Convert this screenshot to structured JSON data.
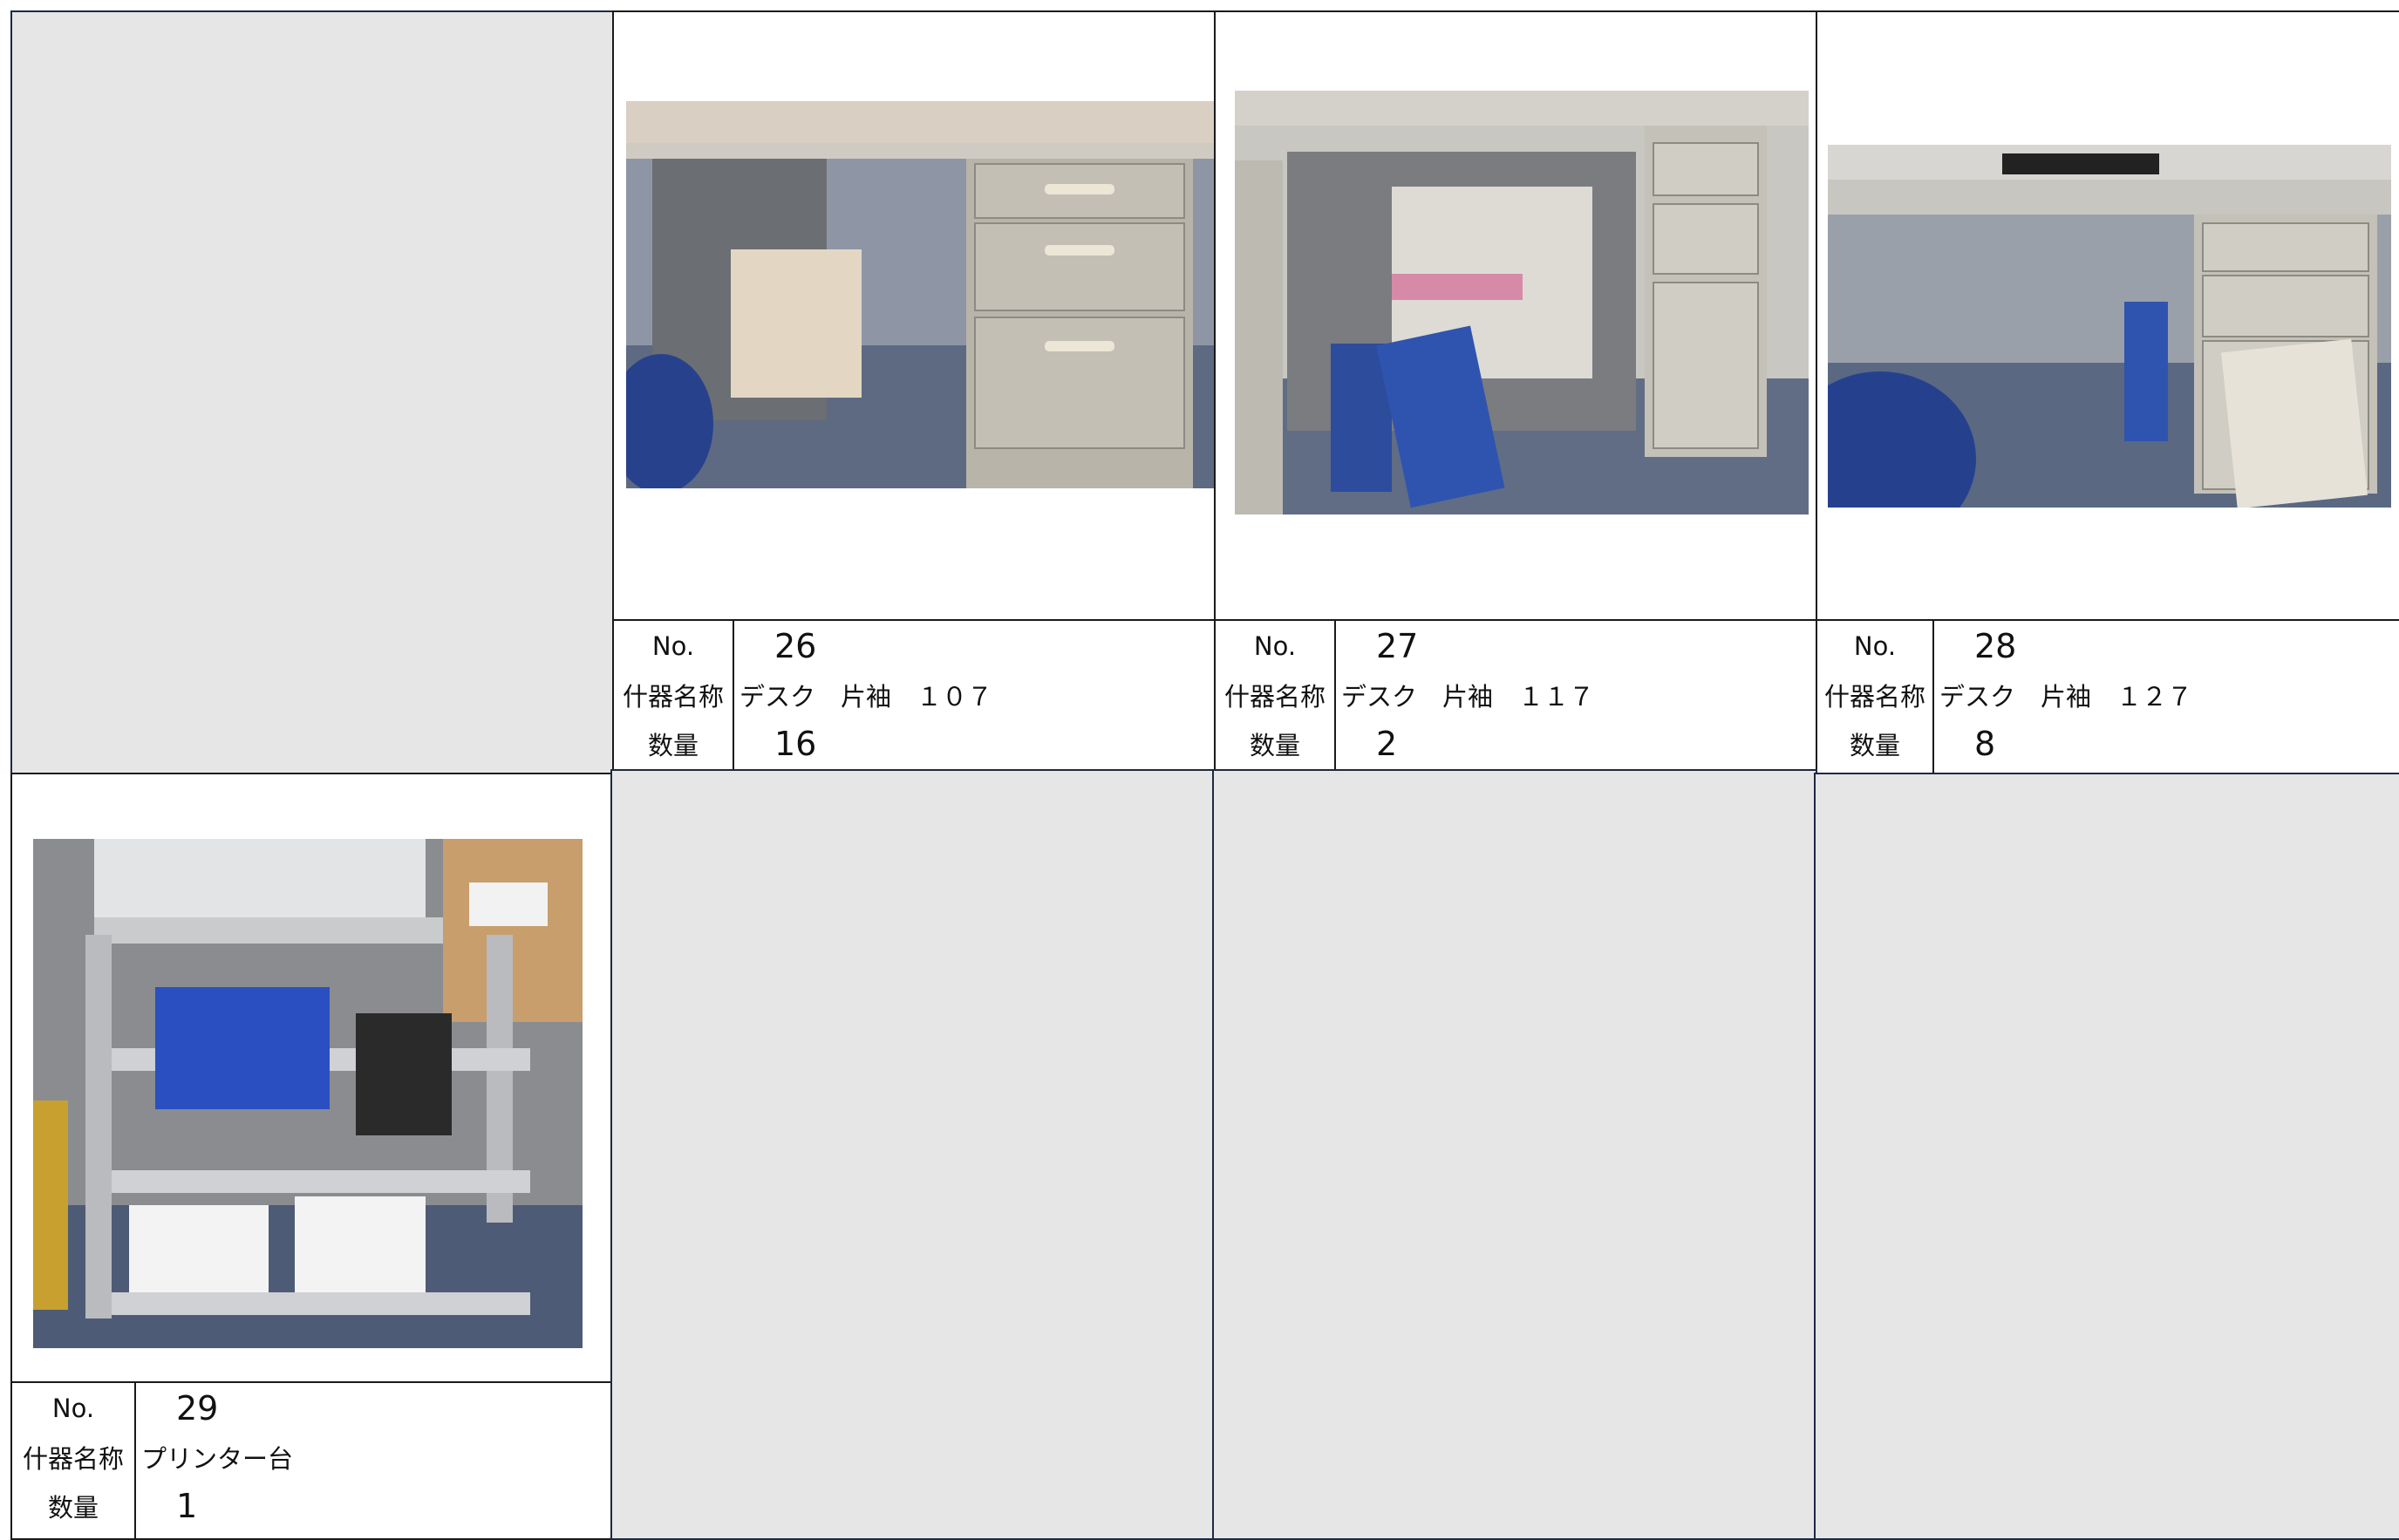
{
  "items": [
    {
      "no_label": "No.",
      "no": "26",
      "name_label": "什器名称",
      "name": "デスク　片袖　１０７",
      "qty_label": "数量",
      "qty": "16",
      "photo_icon": "desk-photo"
    },
    {
      "no_label": "No.",
      "no": "27",
      "name_label": "什器名称",
      "name": "デスク　片袖　１１７",
      "qty_label": "数量",
      "qty": "2",
      "photo_icon": "desk-photo"
    },
    {
      "no_label": "No.",
      "no": "28",
      "name_label": "什器名称",
      "name": "デスク　片袖　１２７",
      "qty_label": "数量",
      "qty": "8",
      "photo_icon": "desk-photo"
    },
    {
      "no_label": "No.",
      "no": "29",
      "name_label": "什器名称",
      "name": "プリンター台",
      "qty_label": "数量",
      "qty": "1",
      "photo_icon": "printer-stand-photo"
    }
  ],
  "colors": {
    "empty_cell": "#e6e6e6",
    "border": "#1a1a1a",
    "desk": "#b8b4aa",
    "floor": "#5d6a82"
  }
}
